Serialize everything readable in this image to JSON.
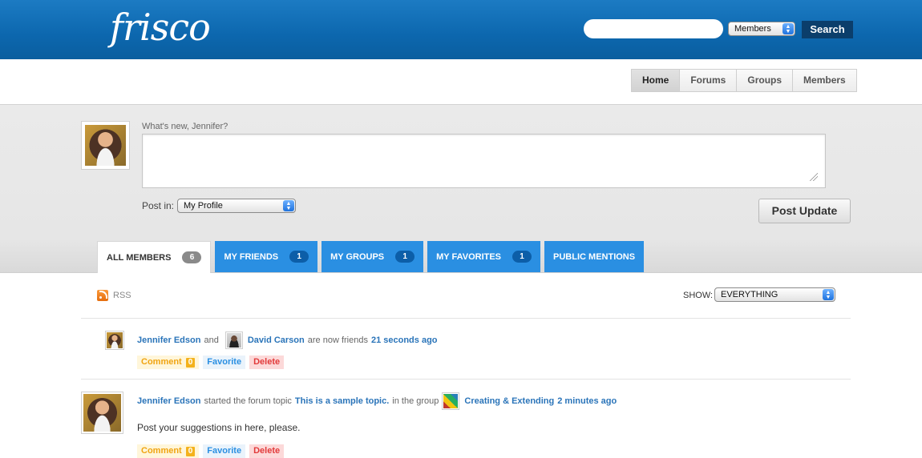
{
  "header": {
    "logo": "frisco",
    "search": {
      "placeholder": "",
      "value": "",
      "scope": "Members",
      "button": "Search"
    }
  },
  "nav": [
    "Home",
    "Forums",
    "Groups",
    "Members"
  ],
  "post_form": {
    "prompt": "What's new, Jennifer?",
    "post_in_label": "Post in:",
    "post_in_value": "My Profile",
    "submit": "Post Update"
  },
  "tabs": [
    {
      "label": "ALL MEMBERS",
      "count": "6",
      "active": true
    },
    {
      "label": "MY FRIENDS",
      "count": "1"
    },
    {
      "label": "MY GROUPS",
      "count": "1"
    },
    {
      "label": "MY FAVORITES",
      "count": "1"
    },
    {
      "label": "PUBLIC MENTIONS",
      "count": ""
    }
  ],
  "filter": {
    "rss": "RSS",
    "show_label": "SHOW:",
    "show_value": "EVERYTHING"
  },
  "activity": [
    {
      "user": "Jennifer Edson",
      "and": "and",
      "friend": "David Carson",
      "verb": "are now friends",
      "time": "21 seconds ago",
      "actions": {
        "comment": "Comment",
        "comment_count": "0",
        "favorite": "Favorite",
        "delete": "Delete"
      }
    },
    {
      "user": "Jennifer Edson",
      "verb": "started the forum topic",
      "topic": "This is a sample topic.",
      "in_group": "in the group",
      "group": "Creating & Extending",
      "time": "2 minutes ago",
      "content": "Post your suggestions in here, please.",
      "actions": {
        "comment": "Comment",
        "comment_count": "0",
        "favorite": "Favorite",
        "delete": "Delete"
      }
    }
  ]
}
